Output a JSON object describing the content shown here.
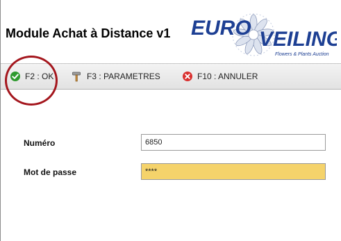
{
  "app": {
    "title": "Module Achat à Distance v1"
  },
  "logo": {
    "brand_part1": "EURO",
    "brand_part2": "VEILING",
    "tagline": "Flowers & Plants Auction",
    "brand_color": "#1d3f93",
    "tagline_color": "#1d3f93",
    "flower_color": "#9aa8c8"
  },
  "toolbar": {
    "ok_label": "F2 : OK",
    "params_label": "F3 : PARAMETRES",
    "cancel_label": "F10 : ANNULER",
    "ok_icon": "check-circle-icon",
    "params_icon": "hammer-icon",
    "cancel_icon": "cancel-circle-icon"
  },
  "form": {
    "numero_label": "Numéro",
    "numero_value": "6850",
    "password_label": "Mot de passe",
    "password_value": "****"
  },
  "colors": {
    "ok_green": "#2e9a2e",
    "cancel_red": "#d9302f",
    "highlight_ring": "#a4161d",
    "password_field_bg": "#f5d36b"
  }
}
